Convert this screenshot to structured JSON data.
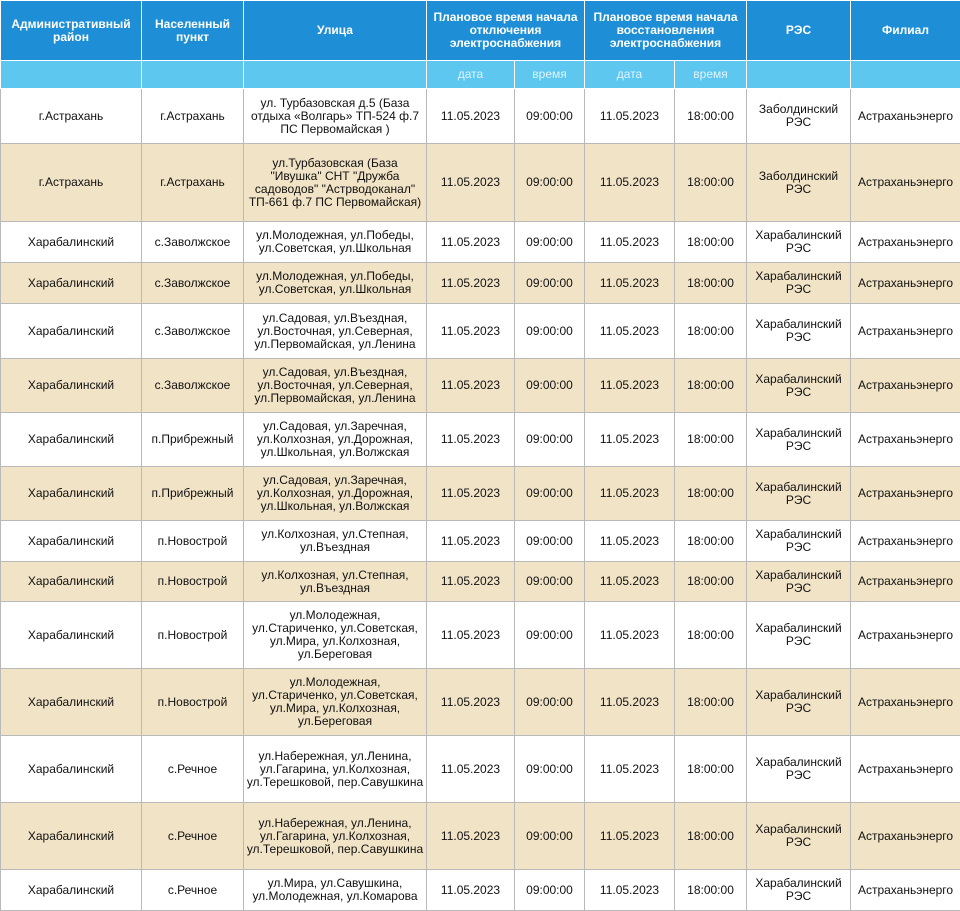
{
  "headers": {
    "district": "Административный район",
    "settlement": "Населенный пункт",
    "street": "Улица",
    "outage_start": "Плановое время начала отключения электроснабжения",
    "restore": "Плановое время начала восстановления электроснабжения",
    "res": "РЭС",
    "branch": "Филиал"
  },
  "subheaders": {
    "date1": "дата",
    "time1": "время",
    "date2": "дата",
    "time2": "время"
  },
  "rows": [
    {
      "district": "г.Астрахань",
      "settlement": "г.Астрахань",
      "street": "ул. Турбазовская д.5 (База отдыха «Волгарь» ТП-524 ф.7 ПС Первомайская )",
      "date1": "11.05.2023",
      "time1": "09:00:00",
      "date2": "11.05.2023",
      "time2": "18:00:00",
      "res": "Заболдинский РЭС",
      "branch": "Астраханьэнерго"
    },
    {
      "district": "г.Астрахань",
      "settlement": "г.Астрахань",
      "street": "ул.Турбазовская (База \"Ивушка\" СНТ \"Дружба садоводов\" \"Астрводоканал\" ТП-661 ф.7 ПС Первомайская)",
      "date1": "11.05.2023",
      "time1": "09:00:00",
      "date2": "11.05.2023",
      "time2": "18:00:00",
      "res": "Заболдинский РЭС",
      "branch": "Астраханьэнерго"
    },
    {
      "district": "Харабалинский",
      "settlement": "с.Заволжское",
      "street": "ул.Молодежная, ул.Победы, ул.Советская, ул.Школьная",
      "date1": "11.05.2023",
      "time1": "09:00:00",
      "date2": "11.05.2023",
      "time2": "18:00:00",
      "res": "Харабалинский РЭС",
      "branch": "Астраханьэнерго"
    },
    {
      "district": "Харабалинский",
      "settlement": "с.Заволжское",
      "street": "ул.Молодежная, ул.Победы, ул.Советская, ул.Школьная",
      "date1": "11.05.2023",
      "time1": "09:00:00",
      "date2": "11.05.2023",
      "time2": "18:00:00",
      "res": "Харабалинский РЭС",
      "branch": "Астраханьэнерго"
    },
    {
      "district": "Харабалинский",
      "settlement": "с.Заволжское",
      "street": "ул.Садовая, ул.Въездная, ул.Восточная, ул.Северная, ул.Первомайская, ул.Ленина",
      "date1": "11.05.2023",
      "time1": "09:00:00",
      "date2": "11.05.2023",
      "time2": "18:00:00",
      "res": "Харабалинский РЭС",
      "branch": "Астраханьэнерго"
    },
    {
      "district": "Харабалинский",
      "settlement": "с.Заволжское",
      "street": "ул.Садовая, ул.Въездная, ул.Восточная, ул.Северная, ул.Первомайская, ул.Ленина",
      "date1": "11.05.2023",
      "time1": "09:00:00",
      "date2": "11.05.2023",
      "time2": "18:00:00",
      "res": "Харабалинский РЭС",
      "branch": "Астраханьэнерго"
    },
    {
      "district": "Харабалинский",
      "settlement": "п.Прибрежный",
      "street": "ул.Садовая, ул.Заречная, ул.Колхозная, ул.Дорожная, ул.Школьная, ул.Волжская",
      "date1": "11.05.2023",
      "time1": "09:00:00",
      "date2": "11.05.2023",
      "time2": "18:00:00",
      "res": "Харабалинский РЭС",
      "branch": "Астраханьэнерго"
    },
    {
      "district": "Харабалинский",
      "settlement": "п.Прибрежный",
      "street": "ул.Садовая, ул.Заречная, ул.Колхозная, ул.Дорожная, ул.Школьная, ул.Волжская",
      "date1": "11.05.2023",
      "time1": "09:00:00",
      "date2": "11.05.2023",
      "time2": "18:00:00",
      "res": "Харабалинский РЭС",
      "branch": "Астраханьэнерго"
    },
    {
      "district": "Харабалинский",
      "settlement": "п.Новострой",
      "street": "ул.Колхозная, ул.Степная, ул.Въездная",
      "date1": "11.05.2023",
      "time1": "09:00:00",
      "date2": "11.05.2023",
      "time2": "18:00:00",
      "res": "Харабалинский РЭС",
      "branch": "Астраханьэнерго"
    },
    {
      "district": "Харабалинский",
      "settlement": "п.Новострой",
      "street": "ул.Колхозная, ул.Степная, ул.Въездная",
      "date1": "11.05.2023",
      "time1": "09:00:00",
      "date2": "11.05.2023",
      "time2": "18:00:00",
      "res": "Харабалинский РЭС",
      "branch": "Астраханьэнерго"
    },
    {
      "district": "Харабалинский",
      "settlement": "п.Новострой",
      "street": "ул.Молодежная, ул.Стариченко, ул.Советская, ул.Мира, ул.Колхозная, ул.Береговая",
      "date1": "11.05.2023",
      "time1": "09:00:00",
      "date2": "11.05.2023",
      "time2": "18:00:00",
      "res": "Харабалинский РЭС",
      "branch": "Астраханьэнерго"
    },
    {
      "district": "Харабалинский",
      "settlement": "п.Новострой",
      "street": "ул.Молодежная, ул.Стариченко, ул.Советская, ул.Мира, ул.Колхозная, ул.Береговая",
      "date1": "11.05.2023",
      "time1": "09:00:00",
      "date2": "11.05.2023",
      "time2": "18:00:00",
      "res": "Харабалинский РЭС",
      "branch": "Астраханьэнерго"
    },
    {
      "district": "Харабалинский",
      "settlement": "с.Речное",
      "street": "ул.Набережная, ул.Ленина, ул.Гагарина, ул.Колхозная, ул.Терешковой, пер.Савушкина",
      "date1": "11.05.2023",
      "time1": "09:00:00",
      "date2": "11.05.2023",
      "time2": "18:00:00",
      "res": "Харабалинский РЭС",
      "branch": "Астраханьэнерго"
    },
    {
      "district": "Харабалинский",
      "settlement": "с.Речное",
      "street": "ул.Набережная, ул.Ленина, ул.Гагарина, ул.Колхозная, ул.Терешковой, пер.Савушкина",
      "date1": "11.05.2023",
      "time1": "09:00:00",
      "date2": "11.05.2023",
      "time2": "18:00:00",
      "res": "Харабалинский РЭС",
      "branch": "Астраханьэнерго"
    },
    {
      "district": "Харабалинский",
      "settlement": "с.Речное",
      "street": "ул.Мира, ул.Савушкина, ул.Молодежная, ул.Комарова",
      "date1": "11.05.2023",
      "time1": "09:00:00",
      "date2": "11.05.2023",
      "time2": "18:00:00",
      "res": "Харабалинский РЭС",
      "branch": "Астраханьэнерго"
    }
  ]
}
